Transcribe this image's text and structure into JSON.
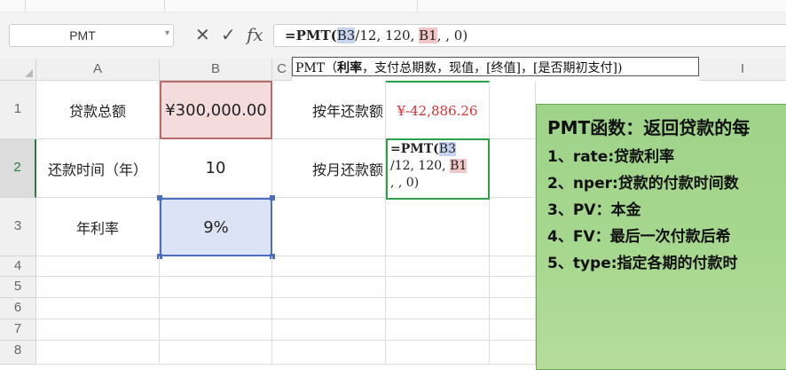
{
  "formula_bar": {
    "name_box": "PMT",
    "cancel_icon": "✕",
    "enter_icon": "✓",
    "fx_icon": "fx",
    "formula_prefix": "=PMT(",
    "ref1": "B3",
    "formula_mid": "/12, 120, ",
    "ref2": "B1",
    "formula_suffix": ", , 0)"
  },
  "tooltip": {
    "prefix": "PMT（",
    "bold_arg": "利率",
    "rest": "，支付总期数，现值，[终值]，[是否期初支付])"
  },
  "columns": [
    "A",
    "B",
    "C",
    "",
    "",
    "",
    "",
    "",
    "I"
  ],
  "rows": [
    "1",
    "2",
    "3",
    "4",
    "5",
    "6",
    "7",
    "8"
  ],
  "cells": {
    "A1": "贷款总额",
    "B1": "¥300,000.00",
    "A2": "还款时间（年）",
    "B2": "10",
    "A3": "年利率",
    "B3": "9%",
    "D1": "按年还款额",
    "E1": "¥-42,886.26",
    "D2": "按月还款额"
  },
  "edit_cell": {
    "line1_prefix": "=PMT(",
    "line1_ref": "B3",
    "line2_text": "/12, 120, ",
    "line2_ref": "B1",
    "line3": ", , 0)"
  },
  "note": {
    "title": "PMT函数：返回贷款的每",
    "items": [
      "1、rate:贷款利率",
      "2、nper:贷款的付款时间数",
      "3、PV：本金",
      "4、FV：最后一次付款后希",
      "5、type:指定各期的付款时"
    ]
  },
  "colors": {
    "b1_fill": "#f4dcdc",
    "b3_fill": "#dce3f5",
    "note_fill": "#a8d890",
    "negative_text": "#e03030",
    "active_border": "#2aa24a"
  }
}
